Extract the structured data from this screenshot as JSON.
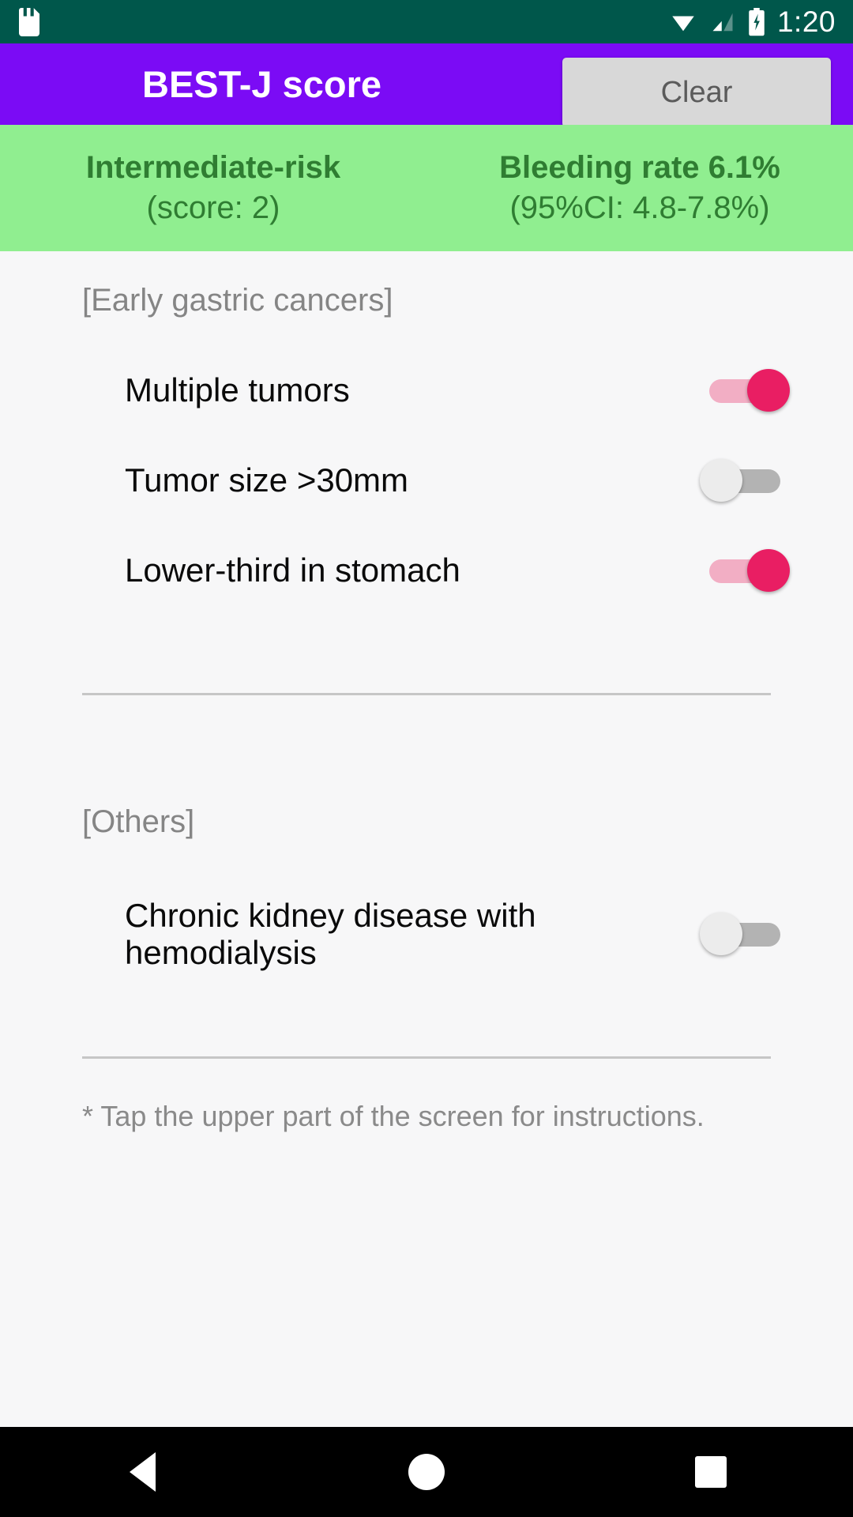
{
  "status_bar": {
    "sdcard_icon": "sdcard-icon",
    "wifi_icon": "wifi-icon",
    "signal_icon": "cellular-signal-icon",
    "battery_icon": "battery-charging-icon",
    "time": "1:20",
    "background_color": "#00574B"
  },
  "app_bar": {
    "title": "BEST-J score",
    "clear_label": "Clear",
    "background_color": "#7B0BF5"
  },
  "result_banner": {
    "background_color": "#90EE90",
    "text_color": "#2F7D32",
    "risk_label": "Intermediate-risk",
    "risk_score": "(score: 2)",
    "bleeding_rate": "Bleeding rate 6.1%",
    "bleeding_ci": "(95%CI: 4.8-7.8%)"
  },
  "sections": [
    {
      "header": "[Early gastric cancers]",
      "items": [
        {
          "label": "Multiple tumors",
          "state": "on"
        },
        {
          "label": "Tumor size >30mm",
          "state": "off"
        },
        {
          "label": "Lower-third in stomach",
          "state": "on"
        }
      ]
    },
    {
      "header": "[Others]",
      "items": [
        {
          "label": "Chronic kidney disease with hemodialysis",
          "state": "off"
        }
      ]
    }
  ],
  "footnote": "* Tap the upper part of the screen for instructions.",
  "nav_bar": {
    "back_icon": "back-triangle-icon",
    "home_icon": "home-circle-icon",
    "recent_icon": "recent-square-icon"
  },
  "colors": {
    "switch_on_thumb": "#E91E63",
    "switch_on_track": "#F2AEC4",
    "switch_off_thumb": "#ECECEC",
    "switch_off_track": "#B3B3B3"
  }
}
